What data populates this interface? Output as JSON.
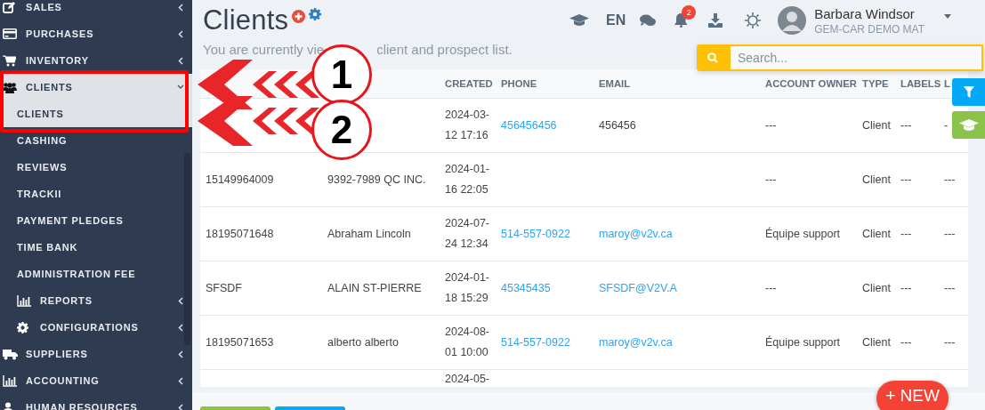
{
  "sidebar": {
    "items": [
      {
        "label": "SALES",
        "expanded": false
      },
      {
        "label": "PURCHASES",
        "expanded": false
      },
      {
        "label": "INVENTORY",
        "expanded": false
      },
      {
        "label": "CLIENTS",
        "expanded": true,
        "children": [
          {
            "label": "CLIENTS",
            "selected": true
          },
          {
            "label": "CASHING",
            "selected": false
          },
          {
            "label": "REVIEWS",
            "selected": false
          },
          {
            "label": "TRACKII",
            "selected": false
          },
          {
            "label": "PAYMENT PLEDGES",
            "selected": false
          },
          {
            "label": "TIME BANK",
            "selected": false
          },
          {
            "label": "ADMINISTRATION FEE",
            "selected": false
          },
          {
            "label": "REPORTS",
            "expanded": false,
            "selected": false
          },
          {
            "label": "CONFIGURATIONS",
            "expanded": false,
            "selected": false
          }
        ]
      },
      {
        "label": "SUPPLIERS",
        "expanded": false
      },
      {
        "label": "ACCOUNTING",
        "expanded": false
      },
      {
        "label": "HUMAN RESOURCES",
        "expanded": false
      }
    ]
  },
  "page": {
    "title": "Clients",
    "subtitle_parts": [
      "You are currently vie",
      "client and prospect list."
    ]
  },
  "topbar": {
    "language": "EN",
    "notifications": "2",
    "user": {
      "name": "Barbara Windsor",
      "company": "GEM-CAR DEMO MAT"
    }
  },
  "search": {
    "placeholder": "Search..."
  },
  "table": {
    "columns": [
      "CREATED",
      "PHONE",
      "EMAIL",
      "ACCOUNT OWNER",
      "TYPE",
      "LABELS",
      "L"
    ],
    "rows": [
      {
        "created": "2024-03-12 17:16",
        "phone": "456456456",
        "email": "456456",
        "owner": "---",
        "type": "Client",
        "labels": "---",
        "column_9": "-"
      },
      {
        "id": "15149964009",
        "name": "9392-7989 QC INC.",
        "created": "2024-01-16 22:05",
        "owner": "---",
        "type": "Client",
        "labels": "---",
        "column_9": "---"
      },
      {
        "id": "18195071648",
        "name": "Abraham Lincoln",
        "created": "2024-07-24 12:34",
        "phone": "514-557-0922",
        "email": "maroy@v2v.ca",
        "owner": "Équipe support",
        "type": "Client",
        "labels": "---",
        "column_9": "---"
      },
      {
        "id": "SFSDF",
        "name": "ALAIN ST-PIERRE",
        "created": "2024-01-18 15:29",
        "phone": "45345435",
        "email": "SFSDF@V2V.A",
        "owner": "---",
        "type": "Client",
        "labels": "---",
        "column_9": "---"
      },
      {
        "id": "18195071653",
        "name": "alberto alberto",
        "created": "2024-08-01 10:00",
        "phone": "514-557-0922",
        "email": "maroy@v2v.ca",
        "owner": "Équipe support",
        "type": "Client",
        "labels": "---",
        "column_9": "---"
      },
      {
        "created": "2024-05-"
      }
    ]
  },
  "new_button": "+ NEW",
  "callouts": [
    {
      "number": "1"
    },
    {
      "number": "2"
    }
  ]
}
